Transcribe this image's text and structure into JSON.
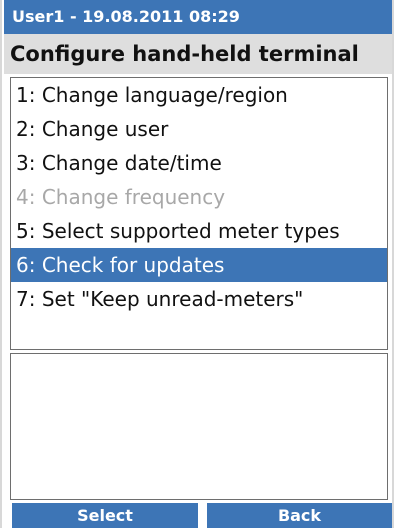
{
  "status_bar": {
    "text": "User1 - 19.08.2011 08:29"
  },
  "title": "Configure hand-held terminal",
  "menu": {
    "items": [
      {
        "label": "1: Change language/region",
        "state": "normal"
      },
      {
        "label": "2: Change user",
        "state": "normal"
      },
      {
        "label": "3: Change date/time",
        "state": "normal"
      },
      {
        "label": "4: Change frequency",
        "state": "disabled"
      },
      {
        "label": "5: Select supported meter types",
        "state": "normal"
      },
      {
        "label": "6: Check for updates",
        "state": "selected"
      },
      {
        "label": "7: Set \"Keep unread-meters\"",
        "state": "normal"
      }
    ]
  },
  "softkeys": {
    "left": "Select",
    "right": "Back"
  },
  "colors": {
    "accent": "#3d75b6",
    "title_bg": "#dedede",
    "disabled_text": "#a8a8a8"
  }
}
